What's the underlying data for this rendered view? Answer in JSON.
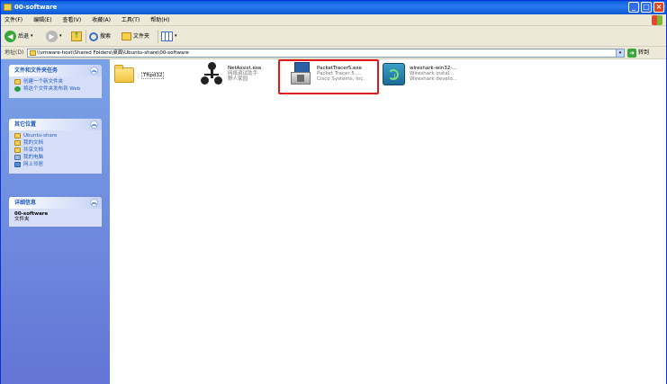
{
  "window": {
    "title": "00-software"
  },
  "menubar": {
    "items": [
      "文件(F)",
      "编辑(E)",
      "查看(V)",
      "收藏(A)",
      "工具(T)",
      "帮助(H)"
    ]
  },
  "toolbar": {
    "back_label": "后退",
    "search_label": "搜索",
    "folders_label": "文件夹"
  },
  "address": {
    "label": "地址(D)",
    "value": "\\\\vmware-host\\Shared Folders\\桌面\\Ubuntu-share\\00-software",
    "go_label": "转到"
  },
  "sidebar": {
    "tasks": {
      "title": "文件和文件夹任务",
      "items": [
        "创建一个新文件夹",
        "将这个文件夹发布到 Web"
      ]
    },
    "places": {
      "title": "其它位置",
      "items": [
        "Ubuntu-share",
        "我的文档",
        "共享文档",
        "我的电脑",
        "网上邻居"
      ]
    },
    "details": {
      "title": "详细信息",
      "name": "00-software",
      "type": "文件夹"
    }
  },
  "files": [
    {
      "name": "Tftpd32",
      "lines": []
    },
    {
      "name": "NetAssist.exe",
      "lines": [
        "网络调试助手",
        "野人家园"
      ]
    },
    {
      "name": "PacketTracer5.exe",
      "lines": [
        "Packet Tracer 5....",
        "Cisco Systems, Inc."
      ]
    },
    {
      "name": "wireshark-win32-...",
      "lines": [
        "Wireshark instal...",
        "Wireshark develo..."
      ]
    }
  ],
  "colors": {
    "highlight": "#e01b1b",
    "sidebar_link": "#215dc6"
  }
}
